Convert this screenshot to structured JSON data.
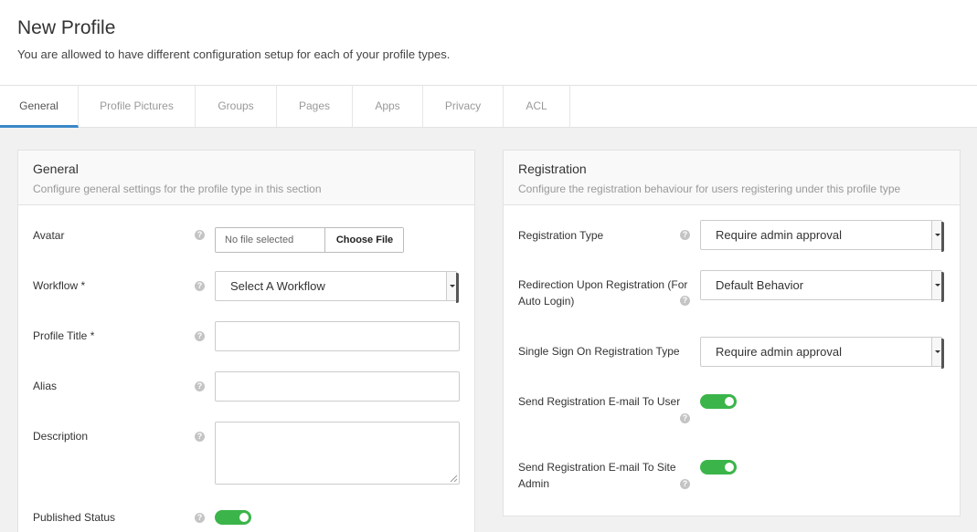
{
  "header": {
    "title": "New Profile",
    "subtitle": "You are allowed to have different configuration setup for each of your profile types."
  },
  "tabs": [
    {
      "label": "General",
      "active": true
    },
    {
      "label": "Profile Pictures",
      "active": false
    },
    {
      "label": "Groups",
      "active": false
    },
    {
      "label": "Pages",
      "active": false
    },
    {
      "label": "Apps",
      "active": false
    },
    {
      "label": "Privacy",
      "active": false
    },
    {
      "label": "ACL",
      "active": false
    }
  ],
  "general": {
    "title": "General",
    "description": "Configure general settings for the profile type in this section",
    "avatar_label": "Avatar",
    "file_status": "No file selected",
    "choose_file_label": "Choose File",
    "workflow_label": "Workflow *",
    "workflow_value": "Select A Workflow",
    "profile_title_label": "Profile Title *",
    "profile_title_value": "",
    "alias_label": "Alias",
    "alias_value": "",
    "description_label": "Description",
    "description_value": "",
    "published_label": "Published Status",
    "published_on": true
  },
  "registration": {
    "title": "Registration",
    "description": "Configure the registration behaviour for users registering under this profile type",
    "type_label": "Registration Type",
    "type_value": "Require admin approval",
    "redirect_label_1": "Redirection Upon Registration (For",
    "redirect_label_2": "Auto Login)",
    "redirect_value": "Default Behavior",
    "sso_label": "Single Sign On Registration Type",
    "sso_value": "Require admin approval",
    "email_user_label": "Send Registration E-mail To User",
    "email_user_on": true,
    "email_admin_label_1": "Send Registration E-mail To Site",
    "email_admin_label_2": "Admin",
    "email_admin_on": true
  },
  "icons": {
    "help": "?",
    "help_icon": "question-circle-icon",
    "dropdown_icon": "caret-down-icon"
  },
  "colors": {
    "accent": "#3a87c8",
    "toggle_on": "#3bb54a"
  }
}
